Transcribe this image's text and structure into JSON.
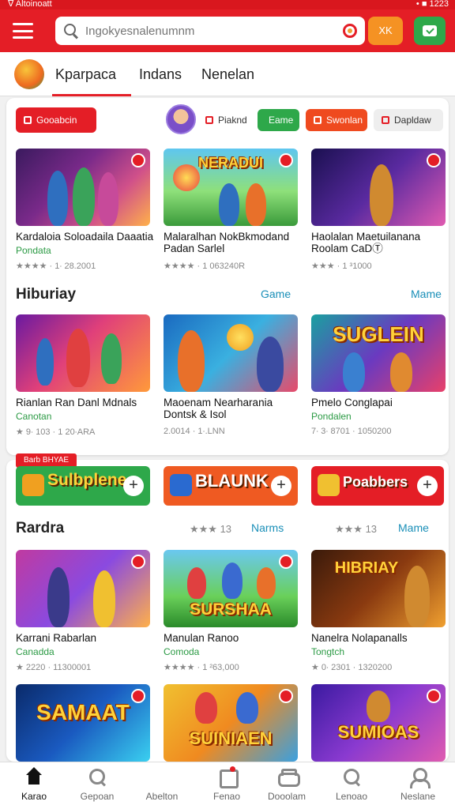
{
  "status_bar": {
    "left": "∇ Altoinoatt",
    "right": "• ■ 1223"
  },
  "header": {
    "search_placeholder": "Ingokyesnalenumnm",
    "xx_label": "XK"
  },
  "tabs": [
    {
      "label": "Kparpaca",
      "active": true
    },
    {
      "label": "Indans",
      "active": false
    },
    {
      "label": "Nenelan",
      "active": false
    }
  ],
  "filters": {
    "primary": "Gooabcin",
    "text_chip": "Piaknd",
    "game": "Eame",
    "stream": "Swonlan",
    "display": "Dapldaw"
  },
  "featured_games": [
    {
      "title": "Kardaloia Soloadaila Daaatia",
      "sub": "Pondata",
      "rating": "★★★★ · 1☨2001",
      "stars": "4"
    },
    {
      "title": "Malaralhan NokBkmodand Padan Sarlel",
      "sub": "",
      "rating": "★★★★ · 1 063240R",
      "tile_text": "NERADUI"
    },
    {
      "title": "Haolalan Maetuilanana Roolam CaDⓉ",
      "sub": "",
      "rating": "★★★ · 1 ³1000"
    }
  ],
  "featured_meta": [
    "★★★★ · 1∙ 28.2001",
    "★★★★ · 1 063240R",
    "★★★ · 1 ³1000"
  ],
  "section_hiburiay": {
    "title": "Hiburiay",
    "link1": "Game",
    "link2": "Mame"
  },
  "hiburiay_games": [
    {
      "title": "Rianlan Ran Danl Mdnals",
      "sub": "Canotan",
      "rating": "★ 9∙ 103 · 1 20∙ARA"
    },
    {
      "title": "Maoenam Nearharania Dontsk & Isol",
      "sub": "",
      "rating": "2.0014 · 1∙.LNN"
    },
    {
      "title": "Pmelo Conglapai",
      "sub": "Pondalen",
      "rating": "7∙ 3∙ 8701 · 1050200",
      "tile_text": "SUGLEIN"
    }
  ],
  "promo_tag": "Barb BHYAE",
  "promos": [
    {
      "label": "Sulbplene",
      "color": "#2ea84a"
    },
    {
      "label": "BLAUNK",
      "color": "#ef5a22"
    },
    {
      "label": "Poabbers",
      "color": "#e41e26"
    }
  ],
  "section_rardra": {
    "title": "Rardra",
    "rating1": "★★★ 13",
    "link1": "Narms",
    "rating2": "★★★ 13",
    "link2": "Mame"
  },
  "rardra_games": [
    {
      "title": "Karrani Rabarlan",
      "sub": "Canadda",
      "rating": "★ 2220 · 11300001"
    },
    {
      "title": "Manulan Ranoo",
      "sub": "Comoda",
      "rating": "★★★★ · 1 ²63,000",
      "tile_text": "SURSHAA"
    },
    {
      "title": "Nanelra Nolapanalls",
      "sub": "Tongtch",
      "rating": "★ 0∙ 2301 · 1320200",
      "tile_text": "HIBRIAY"
    }
  ],
  "bottom_row": [
    {
      "tile_text": "SAMAAT"
    },
    {
      "tile_text": "SUINIAEN"
    },
    {
      "tile_text": "SUMIOAS"
    }
  ],
  "bottom_nav": [
    {
      "label": "Karao",
      "icon": "home-icon",
      "active": true
    },
    {
      "label": "Gepoan",
      "icon": "search-icon",
      "active": false
    },
    {
      "label": "Abelton",
      "icon": "",
      "active": false
    },
    {
      "label": "Fenao",
      "icon": "calendar-icon",
      "active": false
    },
    {
      "label": "Dooolam",
      "icon": "gamepad-icon",
      "active": false
    },
    {
      "label": "Lenoao",
      "icon": "search-icon",
      "active": false
    },
    {
      "label": "Neslane",
      "icon": "user-icon",
      "active": false
    }
  ]
}
